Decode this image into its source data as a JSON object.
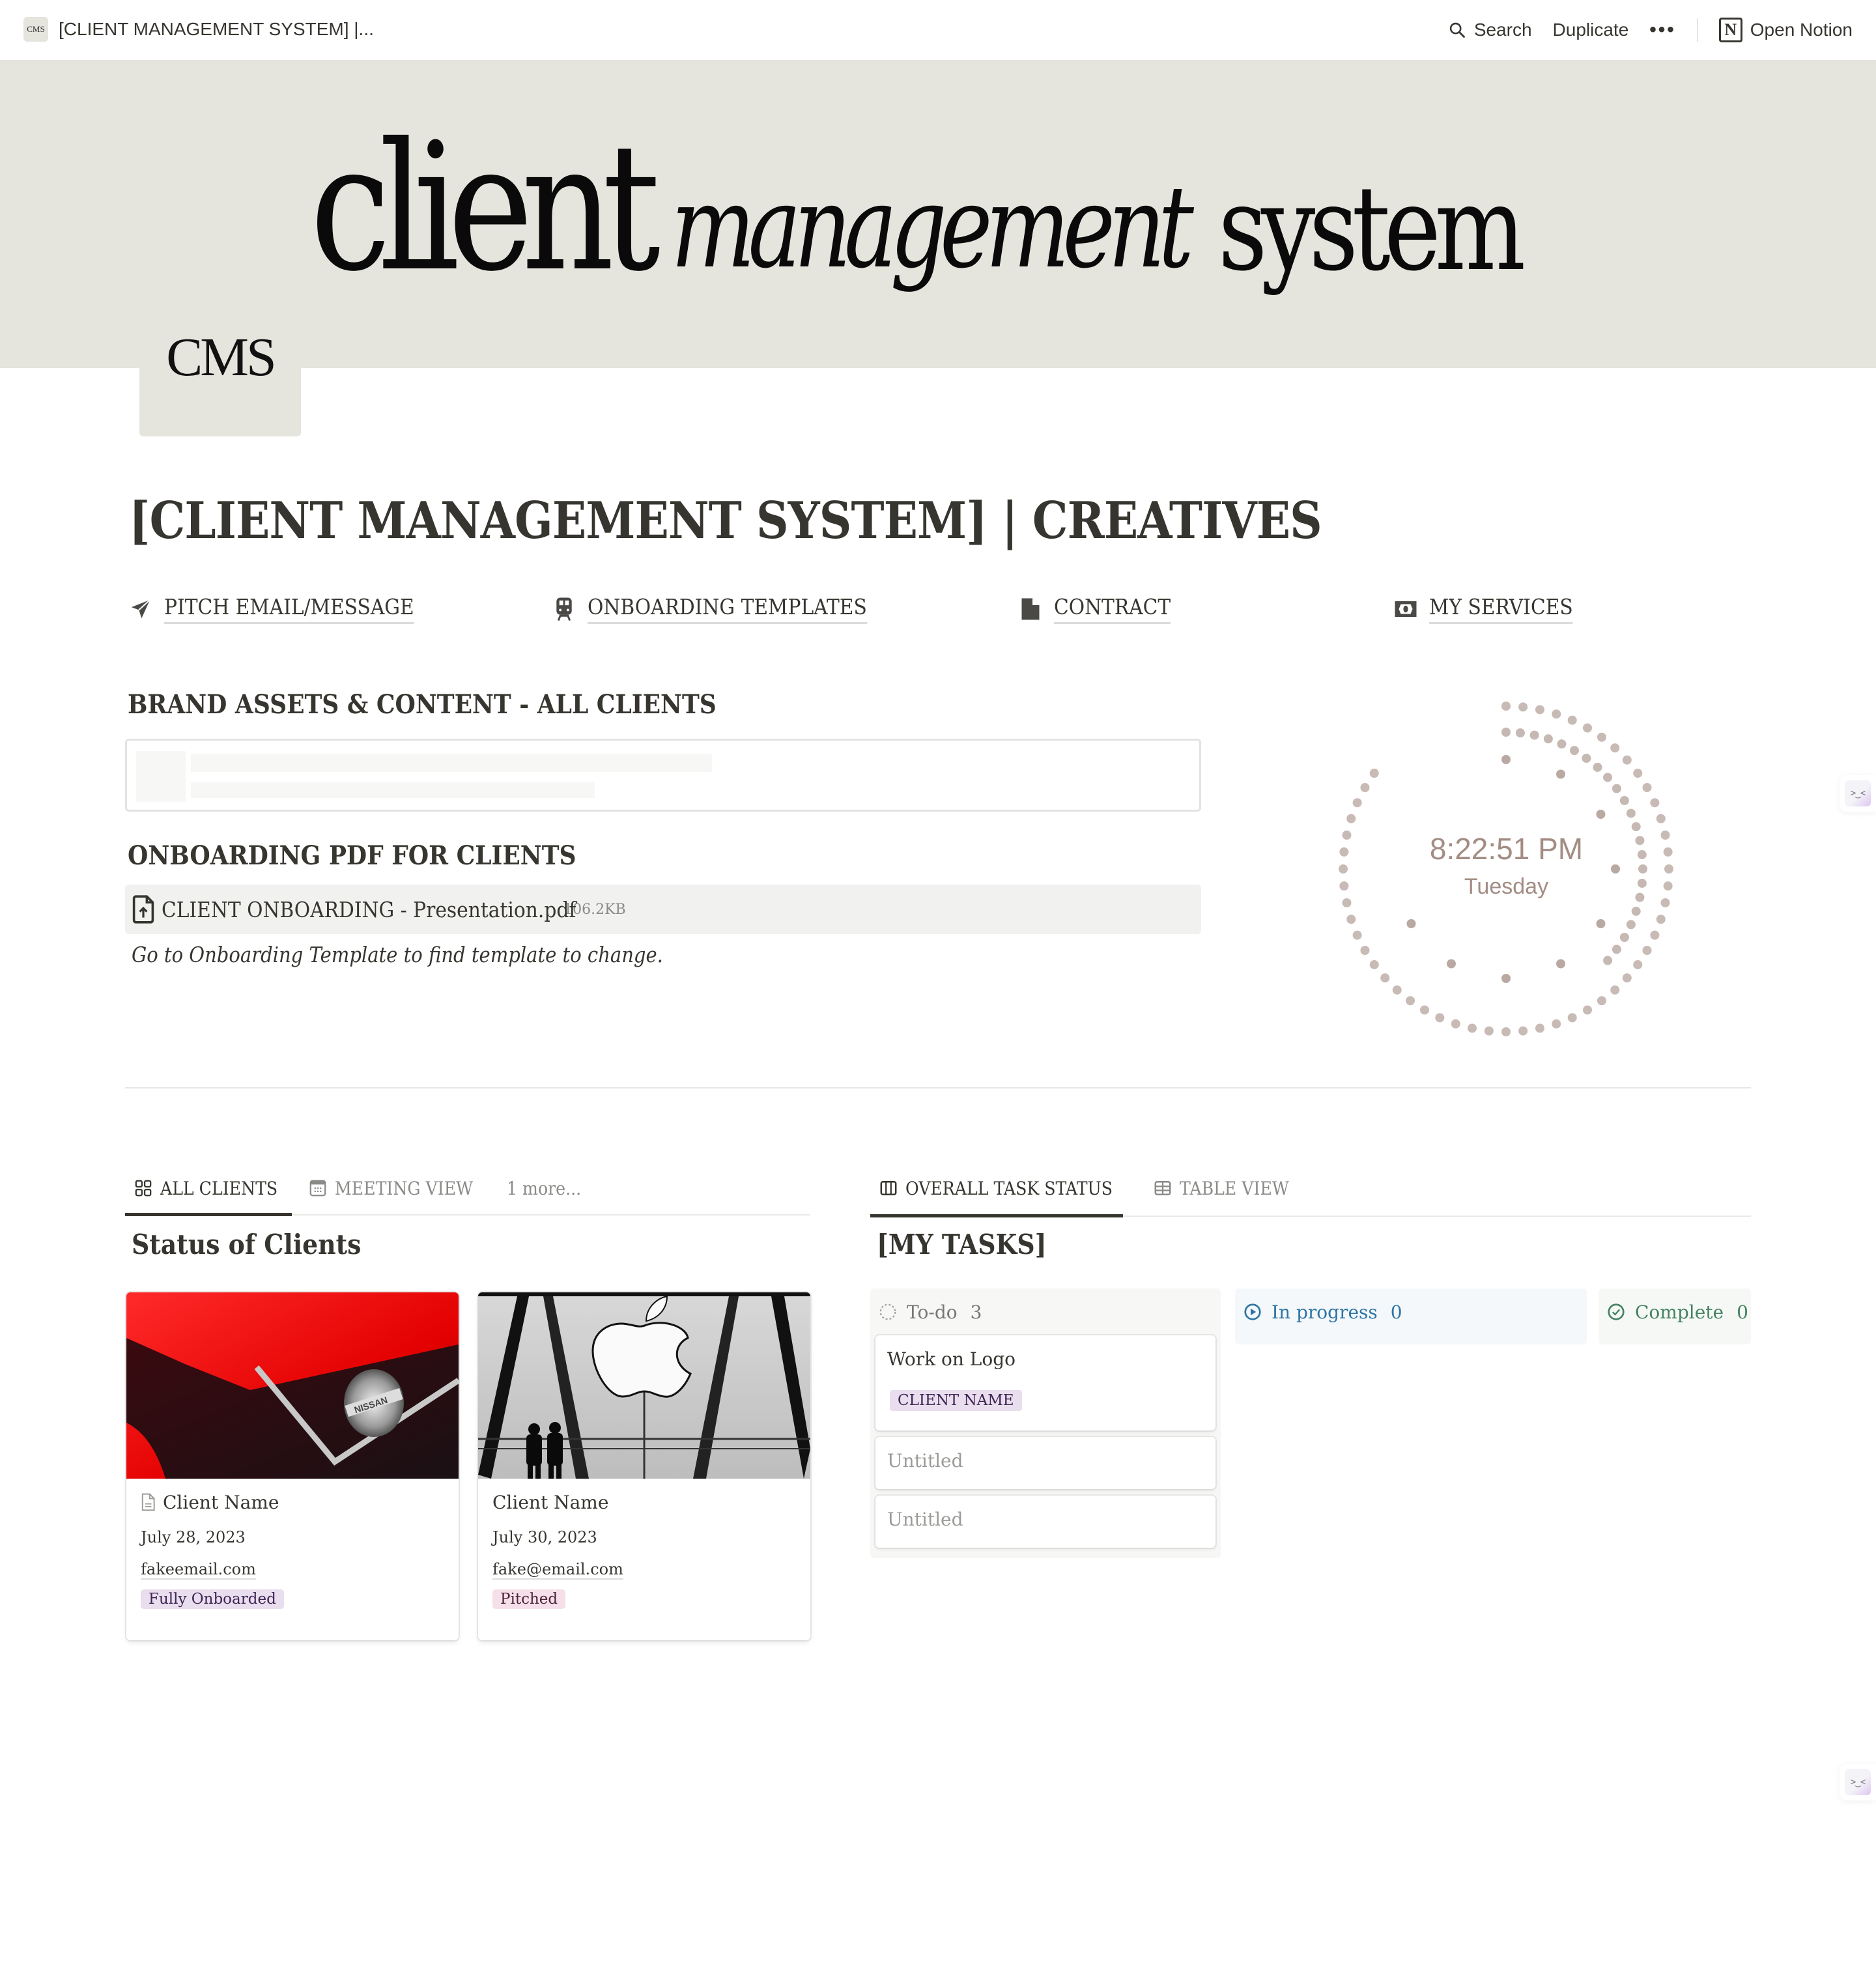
{
  "topbar": {
    "favicon_text": "CMS",
    "page_title": "[CLIENT MANAGEMENT SYSTEM] |...",
    "search_label": "Search",
    "duplicate_label": "Duplicate",
    "more_label": "•••",
    "open_notion_label": "Open Notion",
    "notion_logo_letter": "N"
  },
  "cover": {
    "word_client": "client",
    "word_management": "management",
    "word_system": "system",
    "background_color": "#e5e4dd"
  },
  "page_icon": {
    "text": "CMS"
  },
  "page": {
    "title": "[CLIENT MANAGEMENT SYSTEM] | CREATIVES"
  },
  "quick_links": [
    {
      "label": "PITCH EMAIL/MESSAGE",
      "icon": "paper-plane-icon"
    },
    {
      "label": "ONBOARDING TEMPLATES",
      "icon": "train-icon"
    },
    {
      "label": "CONTRACT",
      "icon": "document-icon"
    },
    {
      "label": "MY SERVICES",
      "icon": "money-icon"
    }
  ],
  "brand_assets": {
    "heading": "BRAND ASSETS & CONTENT - ALL CLIENTS"
  },
  "onboarding": {
    "heading": "ONBOARDING PDF FOR CLIENTS",
    "file_name": "CLIENT ONBOARDING - Presentation.pdf",
    "file_size": "106.2KB",
    "note": "Go to Onboarding Template to find template to change."
  },
  "clock": {
    "time": "8:22:51 PM",
    "day": "Tuesday",
    "color": "#a38c84"
  },
  "clients_db": {
    "tabs": [
      {
        "label": "ALL CLIENTS",
        "icon": "gallery-icon",
        "active": true
      },
      {
        "label": "MEETING VIEW",
        "icon": "calendar-icon",
        "active": false
      },
      {
        "label": "1 more...",
        "icon": "",
        "active": false
      }
    ],
    "title": "Status of Clients",
    "cards": [
      {
        "name": "Client Name",
        "date": "July 28, 2023",
        "email": "fakeemail.com",
        "status": "Fully Onboarded",
        "status_color": "purple",
        "cover": "red-car-nissan-badge"
      },
      {
        "name": "Client Name",
        "date": "July 30, 2023",
        "email": "fake@email.com",
        "status": "Pitched",
        "status_color": "pink",
        "cover": "apple-store-silhouettes"
      }
    ]
  },
  "tasks_db": {
    "tabs": [
      {
        "label": "OVERALL TASK STATUS",
        "icon": "board-icon",
        "active": true
      },
      {
        "label": "TABLE VIEW",
        "icon": "table-icon",
        "active": false
      }
    ],
    "title": "[MY TASKS]",
    "columns": [
      {
        "label": "To-do",
        "count": "3",
        "color": "#787774",
        "bg": "#f7f7f5"
      },
      {
        "label": "In progress",
        "count": "0",
        "color": "#2e75a4",
        "bg": "#f4f8fb"
      },
      {
        "label": "Complete",
        "count": "0",
        "color": "#448361",
        "bg": "#f6f8f6"
      }
    ],
    "todo_cards": [
      {
        "title": "Work on Logo",
        "tag": "CLIENT NAME"
      },
      {
        "title": "Untitled",
        "tag": ""
      },
      {
        "title": "Untitled",
        "tag": ""
      }
    ]
  },
  "side_widgets": {
    "face_glyph": ">‿<"
  }
}
